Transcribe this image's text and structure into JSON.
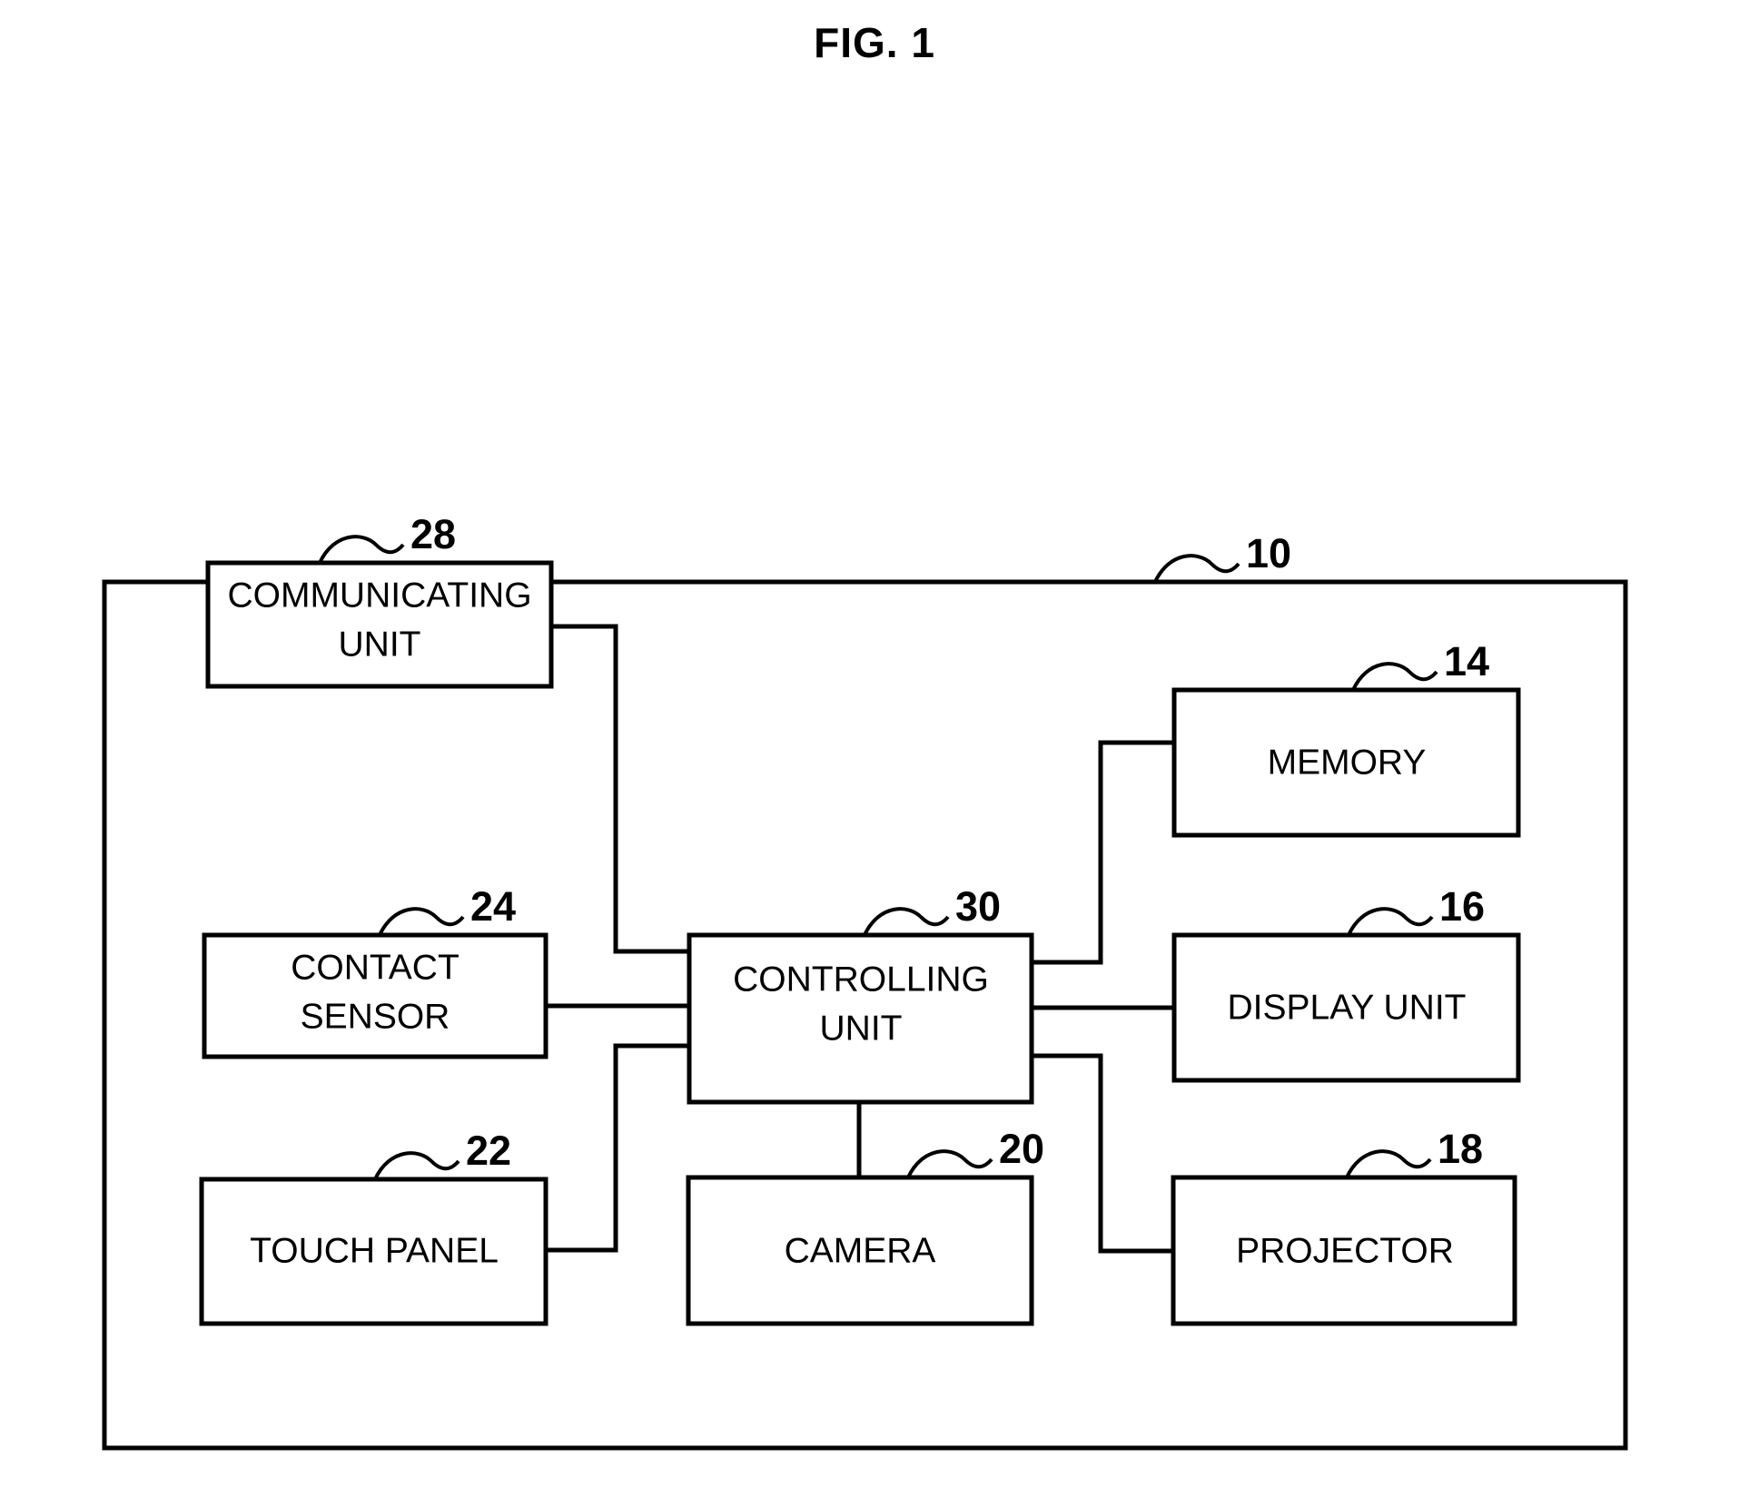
{
  "figure": {
    "title": "FIG. 1"
  },
  "diagram": {
    "type": "block-diagram",
    "outer_block": {
      "label": "",
      "ref": "10"
    },
    "blocks": [
      {
        "id": "communicating-unit",
        "lines": [
          "COMMUNICATING",
          "UNIT"
        ],
        "ref": "28"
      },
      {
        "id": "contact-sensor",
        "lines": [
          "CONTACT",
          "SENSOR"
        ],
        "ref": "24"
      },
      {
        "id": "touch-panel",
        "lines": [
          "TOUCH PANEL"
        ],
        "ref": "22"
      },
      {
        "id": "controlling-unit",
        "lines": [
          "CONTROLLING",
          "UNIT"
        ],
        "ref": "30"
      },
      {
        "id": "camera",
        "lines": [
          "CAMERA"
        ],
        "ref": "20"
      },
      {
        "id": "memory",
        "lines": [
          "MEMORY"
        ],
        "ref": "14"
      },
      {
        "id": "display-unit",
        "lines": [
          "DISPLAY UNIT"
        ],
        "ref": "16"
      },
      {
        "id": "projector",
        "lines": [
          "PROJECTOR"
        ],
        "ref": "18"
      }
    ],
    "connections": [
      {
        "from": "communicating-unit",
        "to": "controlling-unit"
      },
      {
        "from": "contact-sensor",
        "to": "controlling-unit"
      },
      {
        "from": "touch-panel",
        "to": "controlling-unit"
      },
      {
        "from": "controlling-unit",
        "to": "camera"
      },
      {
        "from": "controlling-unit",
        "to": "memory"
      },
      {
        "from": "controlling-unit",
        "to": "display-unit"
      },
      {
        "from": "controlling-unit",
        "to": "projector"
      }
    ]
  }
}
